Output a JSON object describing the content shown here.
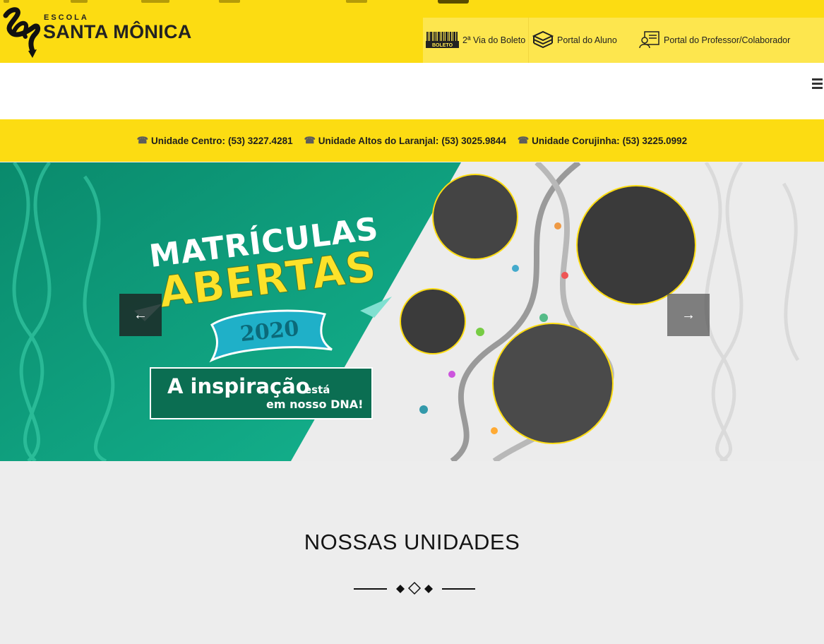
{
  "logo": {
    "line1": "ESCOLA",
    "line2": "SANTA MÔNICA"
  },
  "portals": [
    {
      "label": "2ª Via do Boleto",
      "icon": "barcode-boleto-icon",
      "icon_text": "BOLETO"
    },
    {
      "label": "Portal do Aluno",
      "icon": "books-icon"
    },
    {
      "label": "Portal do Professor/Colaborador",
      "icon": "id-card-icon"
    }
  ],
  "menu": {
    "icon": "hamburger-menu-icon"
  },
  "phones": [
    {
      "unit": "Unidade Centro:",
      "number": "(53) 3227.4281"
    },
    {
      "unit": "Unidade Altos do Laranjal:",
      "number": "(53) 3025.9844"
    },
    {
      "unit": "Unidade Corujinha:",
      "number": "(53) 3225.0992"
    }
  ],
  "slide": {
    "line1": "MATRÍCULAS",
    "line2": "ABERTAS",
    "year": "2020",
    "tagline_main": "A inspiração",
    "tagline_small": "está",
    "tagline_end": "em nosso DNA!",
    "prev": "←",
    "next": "→"
  },
  "section": {
    "title": "NOSSAS UNIDADES"
  },
  "colors": {
    "brand_yellow": "#fcdc12",
    "brand_green": "#0b6e52",
    "teal": "#11a58c"
  }
}
